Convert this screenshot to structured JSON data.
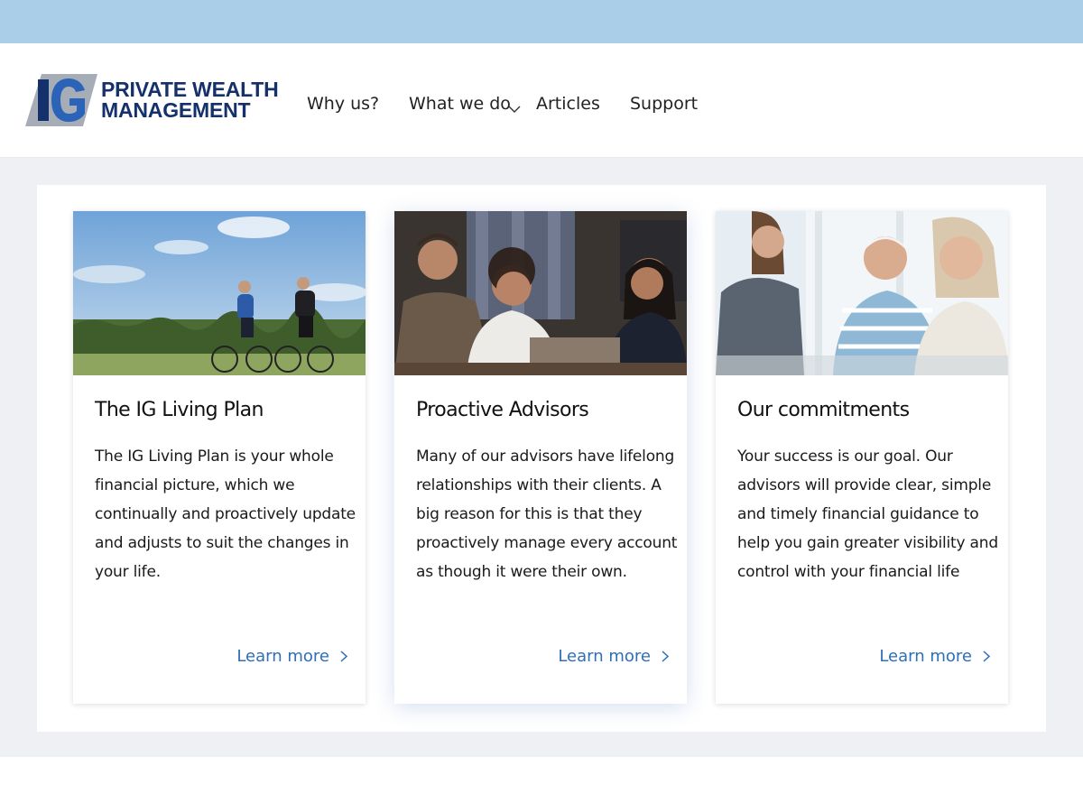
{
  "brand": {
    "mark": "IG",
    "name_line1": "PRIVATE WEALTH",
    "name_line2": "MANAGEMENT",
    "colors": {
      "navy": "#15316b",
      "blue": "#2a63b8",
      "gray": "#a7adb6"
    }
  },
  "nav": {
    "items": [
      {
        "label": "Why us?"
      },
      {
        "label": "What we do",
        "has_dropdown": true
      },
      {
        "label": "Articles"
      },
      {
        "label": "Support"
      }
    ]
  },
  "cards": [
    {
      "title": "The IG Living Plan",
      "body": "The IG Living Plan is your whole financial picture, which we continually and proactively update and adjusts to suit the changes in your life.",
      "link_label": "Learn more",
      "image": "cyclists-photo"
    },
    {
      "title": "Proactive Advisors",
      "body": "Many of our advisors have lifelong relationships with their clients. A big reason for this is that they proactively manage every account as though it were their own.",
      "link_label": "Learn more",
      "image": "advisor-meeting-photo"
    },
    {
      "title": "Our commitments",
      "body": "Your success is our goal. Our advisors will provide clear, simple and timely financial guidance to help you gain greater visibility and control with your financial life",
      "link_label": "Learn more",
      "image": "seniors-conversation-photo"
    }
  ],
  "colors": {
    "top_bar": "#aacde8",
    "link": "#2f6fb8",
    "page_background": "#eef0f4"
  }
}
